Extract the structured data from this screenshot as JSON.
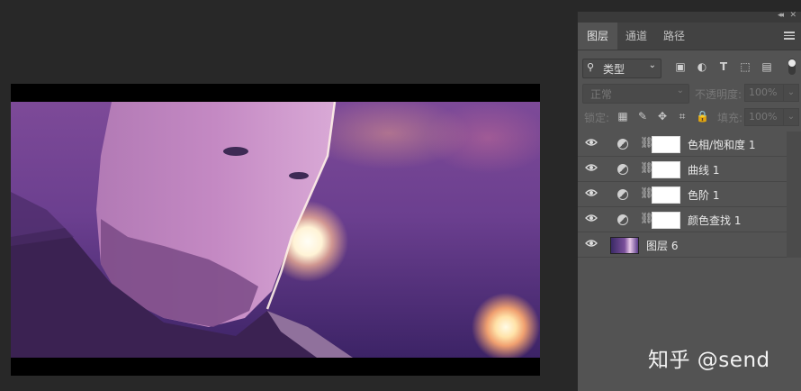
{
  "panel": {
    "tabs": [
      {
        "label": "图层",
        "active": true
      },
      {
        "label": "通道",
        "active": false
      },
      {
        "label": "路径",
        "active": false
      }
    ],
    "filter": {
      "label": "类型",
      "icon": "search-icon"
    },
    "filter_icons": [
      "image-icon",
      "adjustment-icon",
      "text-icon",
      "shape-icon",
      "smart-object-icon"
    ],
    "blend_mode": "正常",
    "opacity_label": "不透明度:",
    "opacity_value": "100%",
    "lock_label": "锁定:",
    "fill_label": "填充:",
    "fill_value": "100%",
    "layers": [
      {
        "name": "色相/饱和度 1",
        "type": "adjustment"
      },
      {
        "name": "曲线 1",
        "type": "adjustment"
      },
      {
        "name": "色阶 1",
        "type": "adjustment"
      },
      {
        "name": "颜色查找 1",
        "type": "adjustment"
      },
      {
        "name": "图层 6",
        "type": "pixel"
      }
    ]
  },
  "watermark": "知乎 @send",
  "colors": {
    "app_bg": "#282828",
    "panel_bg": "#535353",
    "tab_bar": "#424242"
  }
}
